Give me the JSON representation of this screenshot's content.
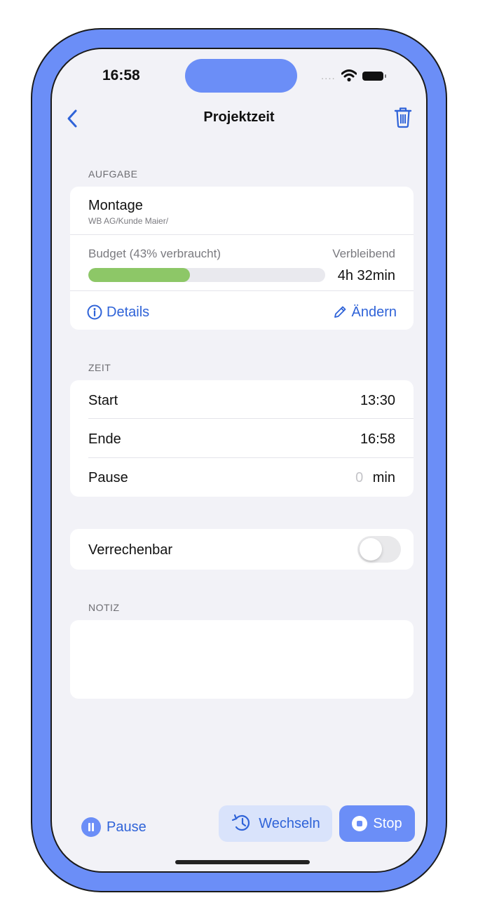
{
  "colors": {
    "accent": "#2f63d8",
    "frame": "#6b8ef7",
    "progress": "#8dc767",
    "background": "#f2f2f7"
  },
  "status_bar": {
    "time": "16:58",
    "signal": "....",
    "icons": [
      "wifi-icon",
      "battery-icon"
    ]
  },
  "nav": {
    "title": "Projektzeit",
    "back_icon": "chevron-left-icon",
    "delete_icon": "trash-icon"
  },
  "task_section": {
    "header": "AUFGABE",
    "name": "Montage",
    "subtitle": "WB AG/Kunde Maier/",
    "budget_label": "Budget (43% verbraucht)",
    "budget_used_fraction": 0.43,
    "remaining_label": "Verbleibend",
    "remaining_value": "4h 32min",
    "details_label": "Details",
    "edit_label": "Ändern"
  },
  "time_section": {
    "header": "ZEIT",
    "rows": [
      {
        "label": "Start",
        "value": "13:30"
      },
      {
        "label": "Ende",
        "value": "16:58"
      }
    ],
    "pause": {
      "label": "Pause",
      "value": "0",
      "unit": "min"
    }
  },
  "billable": {
    "label": "Verrechenbar",
    "enabled": false
  },
  "note_section": {
    "header": "NOTIZ",
    "text": ""
  },
  "bottom_bar": {
    "pause_label": "Pause",
    "switch_label": "Wechseln",
    "stop_label": "Stop"
  }
}
